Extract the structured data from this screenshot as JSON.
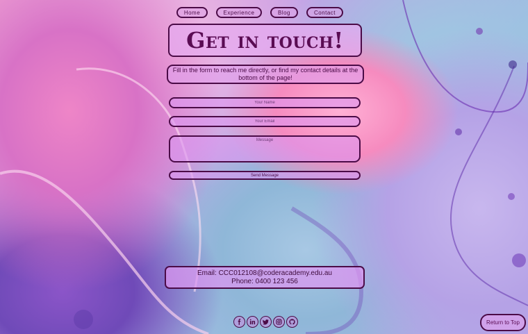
{
  "nav": {
    "home": "Home",
    "experience": "Experience",
    "blog": "Blog",
    "contact": "Contact"
  },
  "heading": "Get in touch!",
  "intro": "Fill in the form to reach me directly, or find my contact details at the bottom of the page!",
  "form": {
    "name_placeholder": "Your Name",
    "email_placeholder": "Your Email",
    "message_placeholder": "Message",
    "submit_label": "Send Message"
  },
  "contact": {
    "email_line": "Email: CCC012108@coderacademy.edu.au",
    "phone_line": "Phone: 0400 123 456"
  },
  "social": [
    "facebook-icon",
    "linkedin-icon",
    "twitter-icon",
    "instagram-icon",
    "github-icon"
  ],
  "return_top": "Return to Top",
  "colors": {
    "accent": "#4b0b47",
    "title_text": "#5a0c53",
    "panel": "#dc96f0"
  }
}
